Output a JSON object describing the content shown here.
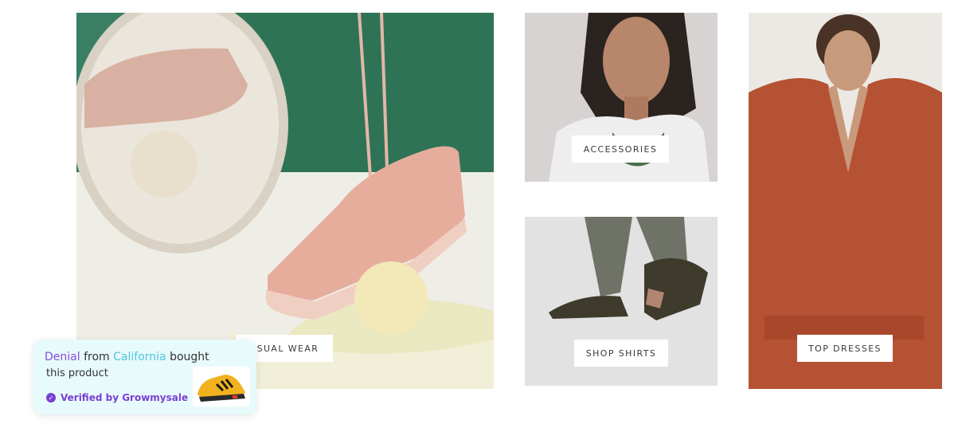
{
  "tiles": [
    {
      "key": "casual",
      "label": "CASUAL WEAR",
      "visible_label": "ASUAL WEAR"
    },
    {
      "key": "accessories",
      "label": "ACCESSORIES"
    },
    {
      "key": "shirts",
      "label": "SHOP SHIRTS"
    },
    {
      "key": "dresses",
      "label": "TOP DRESSES"
    }
  ],
  "popup": {
    "name": "Denial",
    "from_word": "from",
    "place": "California",
    "bought_word": "bought",
    "line2": "this product",
    "verified": "Verified by Growmysale"
  },
  "colors": {
    "popup_bg": "#e7fafc",
    "name_purple": "#8a4dd6",
    "place_cyan": "#4fc7e0",
    "verified_purple": "#7b3fd4"
  }
}
